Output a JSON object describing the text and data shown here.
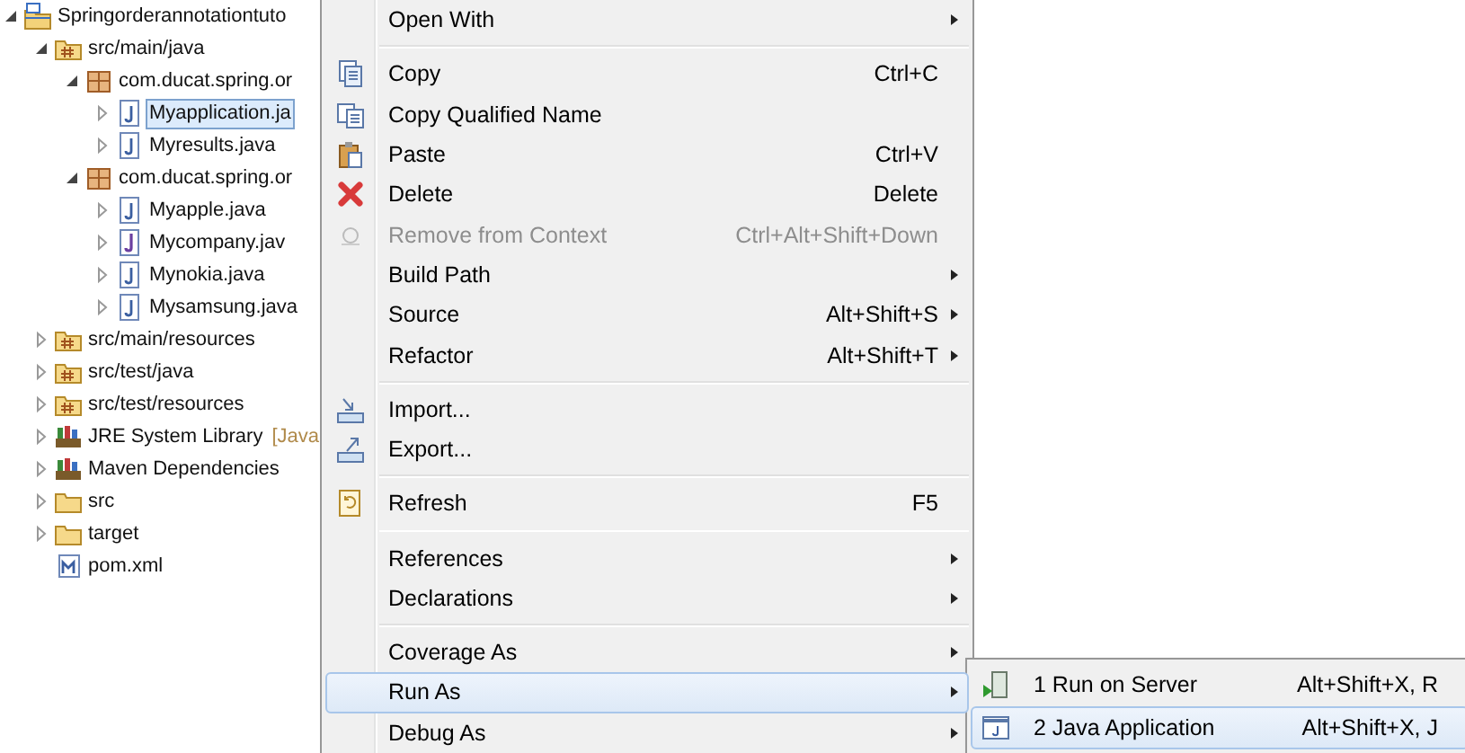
{
  "tree": [
    {
      "label": "Springorderannotationtuto",
      "kind": "project",
      "expanded": true,
      "selected": false,
      "children": [
        {
          "label": "src/main/java",
          "kind": "source-folder",
          "expanded": true,
          "selected": false,
          "children": [
            {
              "label": "com.ducat.spring.or",
              "kind": "package",
              "expanded": true,
              "selected": false,
              "children": [
                {
                  "label": "Myapplication.ja",
                  "kind": "java",
                  "expanded": false,
                  "selected": true
                },
                {
                  "label": "Myresults.java",
                  "kind": "java",
                  "expanded": false,
                  "selected": false
                }
              ]
            },
            {
              "label": "com.ducat.spring.or",
              "kind": "package",
              "expanded": true,
              "selected": false,
              "children": [
                {
                  "label": "Myapple.java",
                  "kind": "java",
                  "expanded": false,
                  "selected": false
                },
                {
                  "label": "Mycompany.jav",
                  "kind": "interface",
                  "expanded": false,
                  "selected": false
                },
                {
                  "label": "Mynokia.java",
                  "kind": "java",
                  "expanded": false,
                  "selected": false
                },
                {
                  "label": "Mysamsung.java",
                  "kind": "java",
                  "expanded": false,
                  "selected": false
                }
              ]
            }
          ]
        },
        {
          "label": "src/main/resources",
          "kind": "source-folder",
          "expanded": false,
          "selected": false
        },
        {
          "label": "src/test/java",
          "kind": "source-folder",
          "expanded": false,
          "selected": false
        },
        {
          "label": "src/test/resources",
          "kind": "source-folder",
          "expanded": false,
          "selected": false
        },
        {
          "label": "JRE System Library",
          "suffix": "[Java",
          "kind": "library",
          "expanded": false,
          "selected": false
        },
        {
          "label": "Maven Dependencies",
          "kind": "library",
          "expanded": false,
          "selected": false
        },
        {
          "label": "src",
          "kind": "folder",
          "expanded": false,
          "selected": false
        },
        {
          "label": "target",
          "kind": "folder",
          "expanded": false,
          "selected": false
        },
        {
          "label": "pom.xml",
          "kind": "xml",
          "selected": false
        }
      ]
    }
  ],
  "context_menu": [
    {
      "kind": "item",
      "label": "Open With",
      "submenu": true,
      "disabled": false,
      "selected": false
    },
    {
      "kind": "separator"
    },
    {
      "kind": "item",
      "label": "Copy",
      "shortcut": "Ctrl+C",
      "submenu": false,
      "disabled": false,
      "selected": false
    },
    {
      "kind": "item",
      "label": "Copy Qualified Name",
      "submenu": false,
      "disabled": false,
      "selected": false
    },
    {
      "kind": "item",
      "label": "Paste",
      "shortcut": "Ctrl+V",
      "submenu": false,
      "disabled": false,
      "selected": false
    },
    {
      "kind": "item",
      "label": "Delete",
      "shortcut": "Delete",
      "submenu": false,
      "disabled": false,
      "selected": false
    },
    {
      "kind": "item",
      "label": "Remove from Context",
      "shortcut": "Ctrl+Alt+Shift+Down",
      "submenu": false,
      "disabled": true,
      "selected": false
    },
    {
      "kind": "item",
      "label": "Build Path",
      "submenu": true,
      "disabled": false,
      "selected": false
    },
    {
      "kind": "item",
      "label": "Source",
      "shortcut": "Alt+Shift+S",
      "submenu": true,
      "disabled": false,
      "selected": false
    },
    {
      "kind": "item",
      "label": "Refactor",
      "shortcut": "Alt+Shift+T",
      "submenu": true,
      "disabled": false,
      "selected": false
    },
    {
      "kind": "separator"
    },
    {
      "kind": "item",
      "label": "Import...",
      "submenu": false,
      "disabled": false,
      "selected": false
    },
    {
      "kind": "item",
      "label": "Export...",
      "submenu": false,
      "disabled": false,
      "selected": false
    },
    {
      "kind": "separator"
    },
    {
      "kind": "item",
      "label": "Refresh",
      "shortcut": "F5",
      "submenu": false,
      "disabled": false,
      "selected": false
    },
    {
      "kind": "separator"
    },
    {
      "kind": "item",
      "label": "References",
      "submenu": true,
      "disabled": false,
      "selected": false
    },
    {
      "kind": "item",
      "label": "Declarations",
      "submenu": true,
      "disabled": false,
      "selected": false
    },
    {
      "kind": "separator"
    },
    {
      "kind": "item",
      "label": "Coverage As",
      "submenu": true,
      "disabled": false,
      "selected": false
    },
    {
      "kind": "item",
      "label": "Run As",
      "submenu": true,
      "disabled": false,
      "selected": true
    },
    {
      "kind": "item",
      "label": "Debug As",
      "submenu": true,
      "disabled": false,
      "selected": false
    }
  ],
  "submenu": [
    {
      "label": "1 Run on Server",
      "shortcut": "Alt+Shift+X, R",
      "selected": false
    },
    {
      "label": "2 Java Application",
      "shortcut": "Alt+Shift+X, J",
      "selected": true
    }
  ]
}
